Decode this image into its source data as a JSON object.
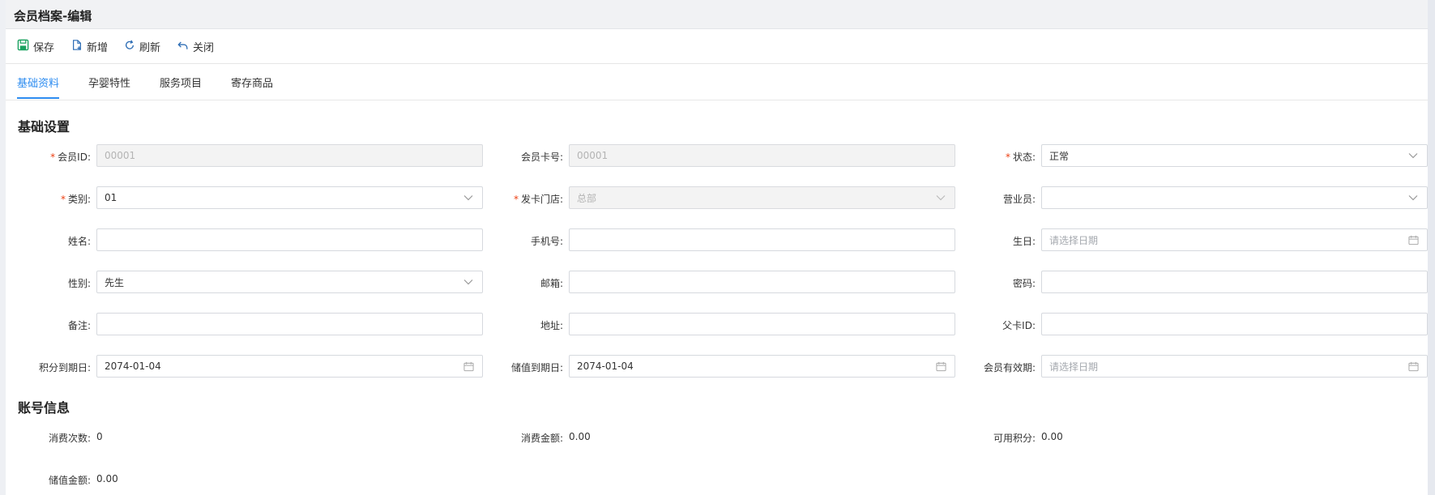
{
  "window": {
    "title": "会员档案-编辑"
  },
  "toolbar": {
    "save_label": "保存",
    "new_label": "新增",
    "refresh_label": "刷新",
    "close_label": "关闭",
    "icon_color": "#19a15f"
  },
  "tabs": [
    {
      "label": "基础资料",
      "active": true
    },
    {
      "label": "孕婴特性",
      "active": false
    },
    {
      "label": "服务项目",
      "active": false
    },
    {
      "label": "寄存商品",
      "active": false
    }
  ],
  "basic": {
    "section_title": "基础设置",
    "member_id": {
      "label": "会员ID",
      "value": "00001",
      "required": true
    },
    "card_no": {
      "label": "会员卡号",
      "value": "00001"
    },
    "status": {
      "label": "状态",
      "value": "正常",
      "required": true
    },
    "category": {
      "label": "类别",
      "value": "01",
      "required": true
    },
    "issuing_store": {
      "label": "发卡门店",
      "value": "总部",
      "required": true
    },
    "salesperson": {
      "label": "营业员",
      "value": ""
    },
    "name": {
      "label": "姓名",
      "value": ""
    },
    "mobile": {
      "label": "手机号",
      "value": ""
    },
    "birthday": {
      "label": "生日",
      "placeholder": "请选择日期"
    },
    "gender": {
      "label": "性别",
      "value": "先生"
    },
    "email": {
      "label": "邮箱",
      "value": ""
    },
    "password": {
      "label": "密码",
      "value": ""
    },
    "remark": {
      "label": "备注",
      "value": ""
    },
    "address": {
      "label": "地址",
      "value": ""
    },
    "parent_card_id": {
      "label": "父卡ID",
      "value": ""
    },
    "points_expiry": {
      "label": "积分到期日",
      "value": "2074-01-04"
    },
    "stored_value_expiry": {
      "label": "储值到期日",
      "value": "2074-01-04"
    },
    "member_validity": {
      "label": "会员有效期",
      "placeholder": "请选择日期"
    }
  },
  "account": {
    "section_title": "账号信息",
    "consume_count": {
      "label": "消费次数",
      "value": "0"
    },
    "consume_amount": {
      "label": "消费金额",
      "value": "0.00"
    },
    "available_points": {
      "label": "可用积分",
      "value": "0.00"
    },
    "stored_amount": {
      "label": "储值金额",
      "value": "0.00"
    }
  },
  "colors": {
    "accent": "#2d8cf0",
    "required": "#ed4014"
  }
}
